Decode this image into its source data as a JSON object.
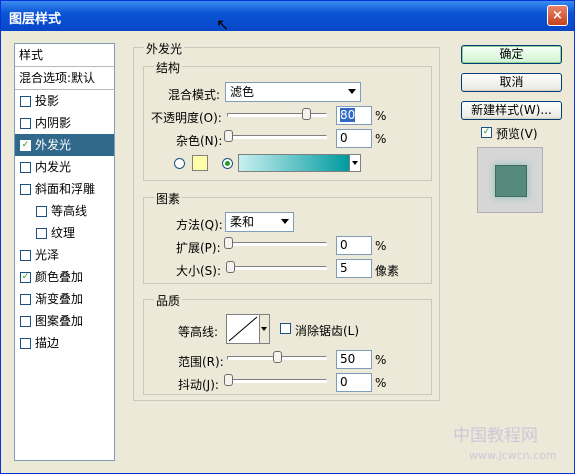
{
  "window": {
    "title": "图层样式",
    "close_glyph": "×"
  },
  "style_list": {
    "header": "样式",
    "blend_default": "混合选项:默认",
    "items": [
      {
        "label": "投影",
        "checked": false
      },
      {
        "label": "内阴影",
        "checked": false
      },
      {
        "label": "外发光",
        "checked": true,
        "selected": true
      },
      {
        "label": "内发光",
        "checked": false
      },
      {
        "label": "斜面和浮雕",
        "checked": false
      },
      {
        "label": "等高线",
        "checked": false,
        "indent": true
      },
      {
        "label": "纹理",
        "checked": false,
        "indent": true
      },
      {
        "label": "光泽",
        "checked": false
      },
      {
        "label": "颜色叠加",
        "checked": true
      },
      {
        "label": "渐变叠加",
        "checked": false
      },
      {
        "label": "图案叠加",
        "checked": false
      },
      {
        "label": "描边",
        "checked": false
      }
    ]
  },
  "outer_glow": {
    "section_title": "外发光",
    "structure": {
      "title": "结构",
      "blend_mode_label": "混合模式:",
      "blend_mode_value": "滤色",
      "opacity_label": "不透明度(O):",
      "opacity_value": "80",
      "opacity_unit": "%",
      "noise_label": "杂色(N):",
      "noise_value": "0",
      "noise_unit": "%",
      "solid_color": "#ffffaa",
      "gradient_colors": [
        "#c9f0f1",
        "#009a9f"
      ]
    },
    "elements": {
      "title": "图素",
      "method_label": "方法(Q):",
      "method_value": "柔和",
      "spread_label": "扩展(P):",
      "spread_value": "0",
      "spread_unit": "%",
      "size_label": "大小(S):",
      "size_value": "5",
      "size_unit": "像素"
    },
    "quality": {
      "title": "品质",
      "contour_label": "等高线:",
      "antialias_label": "消除锯齿(L)",
      "antialias_checked": false,
      "range_label": "范围(R):",
      "range_value": "50",
      "range_unit": "%",
      "jitter_label": "抖动(J):",
      "jitter_value": "0",
      "jitter_unit": "%"
    }
  },
  "buttons": {
    "ok": "确定",
    "cancel": "取消",
    "new_style": "新建样式(W)...",
    "preview": "预览(V)",
    "preview_checked": true
  },
  "watermark": {
    "line1": "中国教程网",
    "line2": "www.jcwcn.com"
  }
}
